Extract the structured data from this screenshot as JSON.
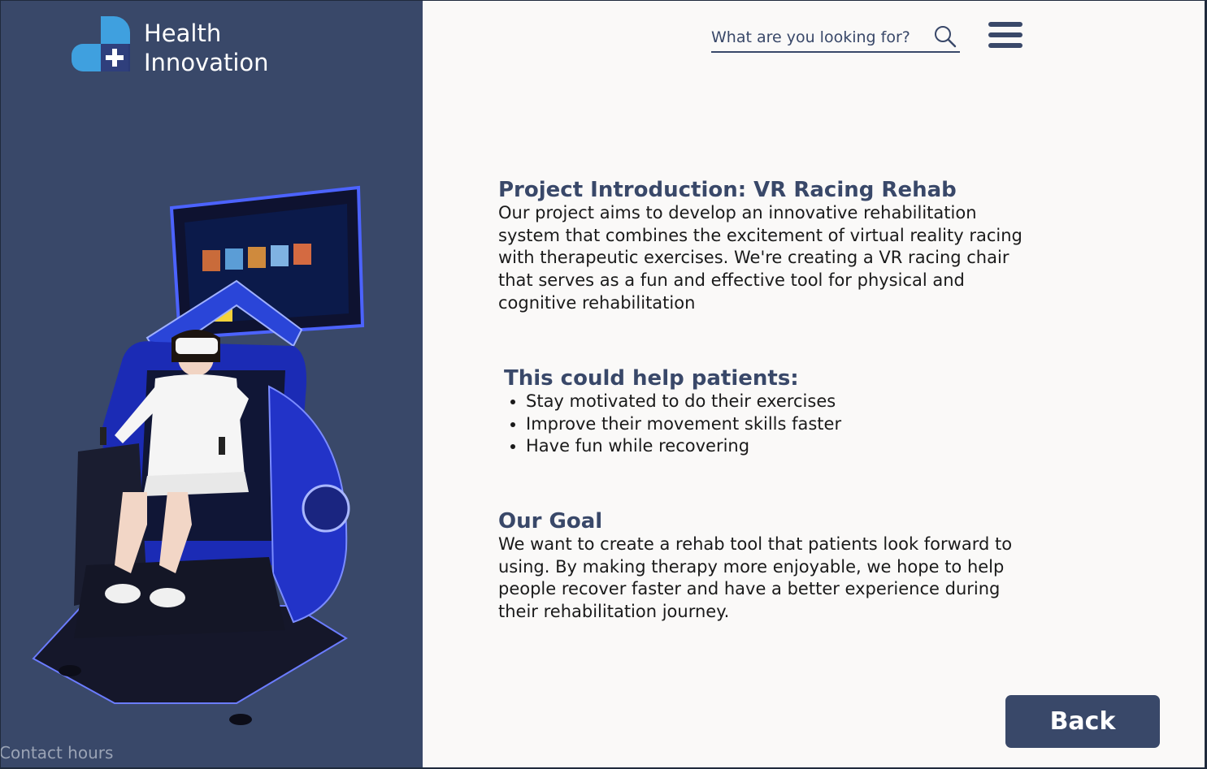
{
  "brand": {
    "line1": "Health",
    "line2": "Innovation",
    "logo_icon": "medical-cross-logo-icon"
  },
  "search": {
    "placeholder": "What are you looking for?",
    "icon": "search-icon"
  },
  "menu": {
    "icon": "hamburger-menu-icon"
  },
  "intro": {
    "heading": "Project Introduction: VR Racing Rehab",
    "lines": [
      "Our project aims to develop an innovative rehabilitation",
      "system that combines the excitement of virtual reality racing",
      "with therapeutic exercises. We're creating a VR racing chair",
      "that serves as a fun and effective tool for physical and",
      "cognitive rehabilitation"
    ]
  },
  "helps": {
    "heading": "This could help patients:",
    "items": [
      "Stay motivated to do their exercises",
      "Improve their movement skills faster",
      "Have fun while recovering"
    ]
  },
  "goal": {
    "heading": "Our Goal",
    "lines": [
      "We want to create a rehab tool that patients look forward to",
      "using. By making therapy more enjoyable, we hope to help",
      "people recover faster and have a better experience during",
      "their rehabilitation journey."
    ]
  },
  "sidebar": {
    "contact": "Contact hours"
  },
  "back_button": {
    "label": "Back"
  },
  "colors": {
    "navy": "#394869",
    "panel_bg": "#faf9f8",
    "logo_light": "#3fa0df",
    "logo_dark": "#2a3a75"
  }
}
